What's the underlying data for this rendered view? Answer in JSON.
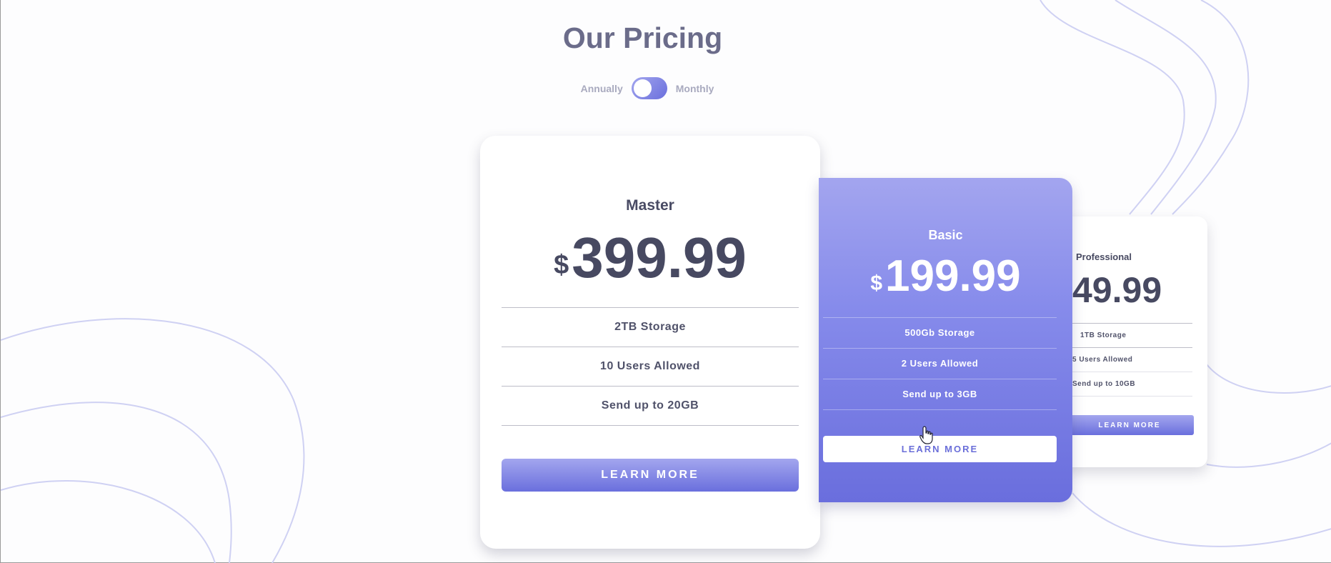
{
  "header": {
    "title": "Our Pricing"
  },
  "billing_toggle": {
    "left_label": "Annually",
    "right_label": "Monthly"
  },
  "plans": [
    {
      "name": "Master",
      "currency": "$",
      "price": "399.99",
      "features": [
        "2TB Storage",
        "10 Users Allowed",
        "Send up to 20GB"
      ],
      "button_label": "LEARN MORE"
    },
    {
      "name": "Basic",
      "currency": "$",
      "price": "199.99",
      "features": [
        "500Gb Storage",
        "2 Users Allowed",
        "Send up to 3GB"
      ],
      "button_label": "LEARN MORE"
    },
    {
      "name": "Professional",
      "currency": "$",
      "price": "49.99",
      "features": [
        "1TB Storage",
        "5 Users Allowed",
        "Send up to 10GB"
      ],
      "button_label": "LEARN MORE"
    }
  ],
  "colors": {
    "accent_light": "#a3a6ee",
    "accent_dark": "#6a6fdd",
    "title": "#6b6c8a",
    "text_dark": "#474961",
    "decor_lines": "#cfd1f3"
  },
  "icons": {
    "cursor": "hand-pointer-icon"
  }
}
